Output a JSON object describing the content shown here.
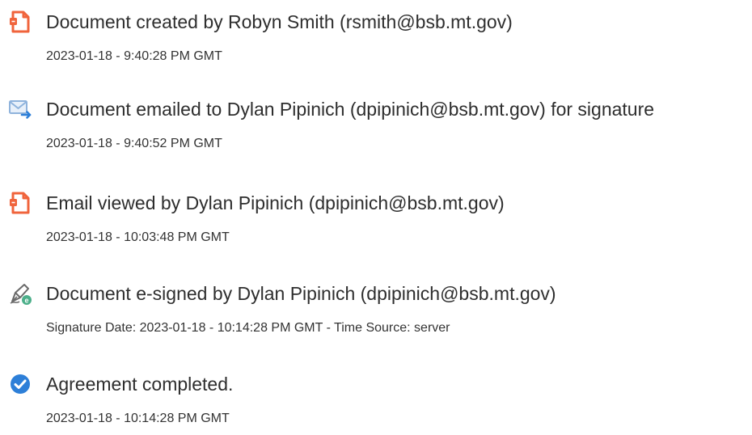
{
  "events": [
    {
      "icon": "document-created-icon",
      "title": "Document created by Robyn Smith (rsmith@bsb.mt.gov)",
      "timestamp": "2023-01-18 - 9:40:28 PM GMT"
    },
    {
      "icon": "email-sent-icon",
      "title": "Document emailed to Dylan Pipinich (dpipinich@bsb.mt.gov) for signature",
      "timestamp": "2023-01-18 - 9:40:52 PM GMT"
    },
    {
      "icon": "document-viewed-icon",
      "title": "Email viewed by Dylan Pipinich (dpipinich@bsb.mt.gov)",
      "timestamp": "2023-01-18 - 10:03:48 PM GMT"
    },
    {
      "icon": "esign-pen-icon",
      "title": "Document e-signed by Dylan Pipinich (dpipinich@bsb.mt.gov)",
      "timestamp": "Signature Date: 2023-01-18 - 10:14:28 PM GMT - Time Source: server"
    },
    {
      "icon": "check-circle-icon",
      "title": "Agreement completed.",
      "timestamp": "2023-01-18 - 10:14:28 PM GMT"
    }
  ],
  "colors": {
    "document_orange": "#f0643c",
    "email_blue": "#8fb3dc",
    "pen_green": "#4caf8a",
    "check_blue": "#2d7fd8",
    "text": "#2e2e2e"
  }
}
